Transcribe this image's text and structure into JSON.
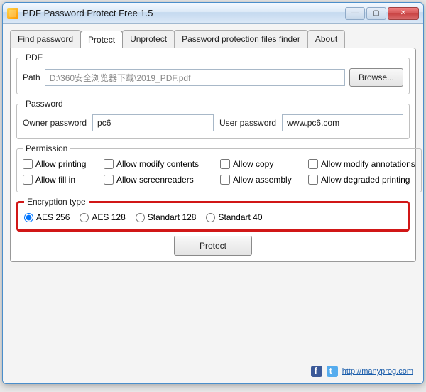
{
  "window": {
    "title": "PDF Password Protect Free 1.5"
  },
  "tabs": {
    "items": [
      {
        "label": "Find password"
      },
      {
        "label": "Protect"
      },
      {
        "label": "Unprotect"
      },
      {
        "label": "Password protection files finder"
      },
      {
        "label": "About"
      }
    ],
    "active_index": 1
  },
  "pdf": {
    "legend": "PDF",
    "path_label": "Path",
    "path_value": "D:\\360安全浏览器下载\\2019_PDF.pdf",
    "browse_label": "Browse..."
  },
  "password": {
    "legend": "Password",
    "owner_label": "Owner password",
    "owner_value": "pc6",
    "user_label": "User password",
    "user_value": "www.pc6.com"
  },
  "permission": {
    "legend": "Permission",
    "items": [
      {
        "label": "Allow printing",
        "checked": false
      },
      {
        "label": "Allow modify contents",
        "checked": false
      },
      {
        "label": "Allow copy",
        "checked": false
      },
      {
        "label": "Allow modify annotations",
        "checked": false
      },
      {
        "label": "Allow fill in",
        "checked": false
      },
      {
        "label": "Allow screenreaders",
        "checked": false
      },
      {
        "label": "Allow assembly",
        "checked": false
      },
      {
        "label": "Allow degraded printing",
        "checked": false
      }
    ]
  },
  "encryption": {
    "legend": "Encryption type",
    "options": [
      {
        "label": "AES 256",
        "selected": true
      },
      {
        "label": "AES 128",
        "selected": false
      },
      {
        "label": "Standart 128",
        "selected": false
      },
      {
        "label": "Standart 40",
        "selected": false
      }
    ]
  },
  "protect_button_label": "Protect",
  "footer": {
    "link": "http://manyprog.com"
  }
}
